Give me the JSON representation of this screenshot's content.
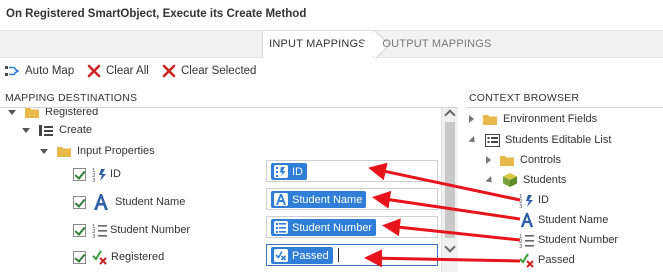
{
  "title": "On Registered SmartObject, Execute its Create Method",
  "tabs": [
    {
      "label": "INPUT MAPPINGS"
    },
    {
      "label": "OUTPUT MAPPINGS"
    }
  ],
  "toolbar": {
    "automap": "Auto Map",
    "clear_all": "Clear All",
    "clear_selected": "Clear Selected"
  },
  "left": {
    "header": "MAPPING DESTINATIONS",
    "registered": "Registered",
    "create": "Create",
    "input_properties": "Input Properties",
    "fields": [
      {
        "label": "ID",
        "mapped": "ID"
      },
      {
        "label": "Student Name",
        "mapped": "Student Name"
      },
      {
        "label": "Student Number",
        "mapped": "Student Number"
      },
      {
        "label": "Registered",
        "mapped": "Passed"
      }
    ]
  },
  "right": {
    "header": "CONTEXT BROWSER",
    "environment_fields": "Environment Fields",
    "students_list": "Students Editable List",
    "controls": "Controls",
    "students": "Students",
    "fields": [
      "ID",
      "Student Name",
      "Student Number",
      "Passed"
    ]
  },
  "colors": {
    "chip_blue": "#2f7ed8",
    "arrow_red": "#e8141c",
    "clear_red": "#cc2222",
    "folder": "#e8b84a"
  }
}
